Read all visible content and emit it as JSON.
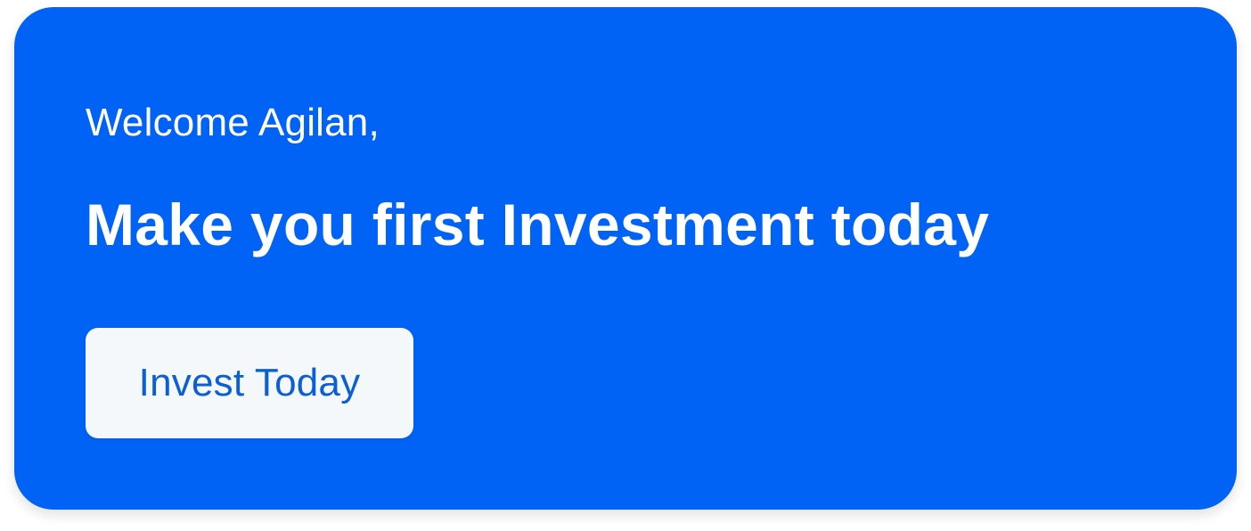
{
  "banner": {
    "greeting": "Welcome Agilan,",
    "headline": "Make you first Investment today",
    "cta_label": "Invest Today"
  },
  "colors": {
    "banner_background": "#0063F5",
    "banner_text": "#FFFFFF",
    "cta_background": "#F5F8FA",
    "cta_text": "#0A5FD6"
  }
}
